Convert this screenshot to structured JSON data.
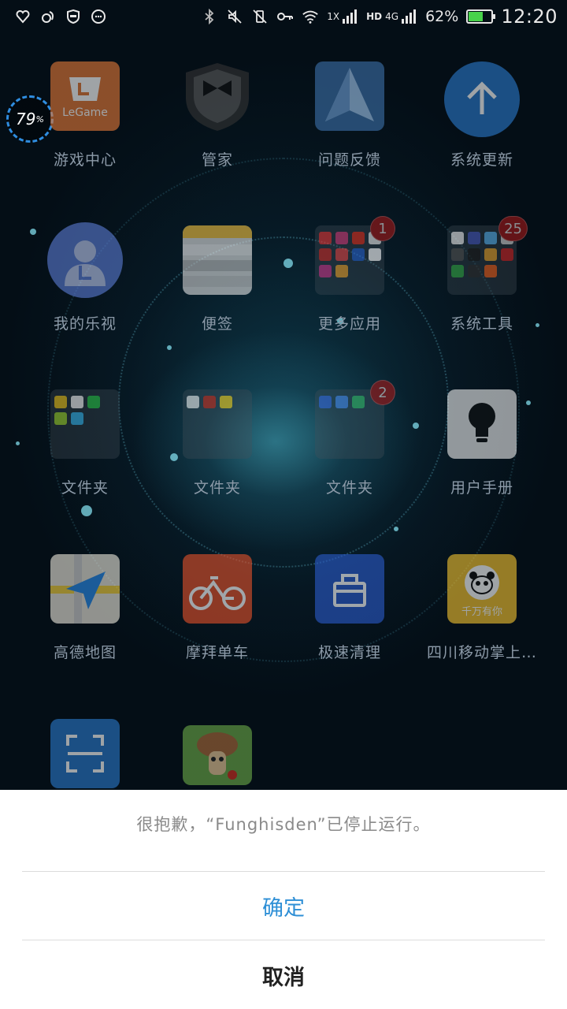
{
  "status_bar": {
    "network_type": "1X",
    "hd_label": "HD",
    "lte_label": "4G",
    "battery_percent": "62%",
    "battery_level": 0.62,
    "time": "12:20"
  },
  "memory_widget": {
    "value": "79",
    "unit": "%"
  },
  "apps": [
    {
      "label": "游戏中心",
      "icon": "legame-icon",
      "icon_text": "LeGame"
    },
    {
      "label": "管家",
      "icon": "butler-icon"
    },
    {
      "label": "问题反馈",
      "icon": "feedback-icon"
    },
    {
      "label": "系统更新",
      "icon": "system-update-icon"
    },
    {
      "label": "我的乐视",
      "icon": "my-letv-icon"
    },
    {
      "label": "便签",
      "icon": "notes-icon"
    },
    {
      "label": "更多应用",
      "icon": "more-apps-folder-icon",
      "badge": "1"
    },
    {
      "label": "系统工具",
      "icon": "system-tools-folder-icon",
      "badge": "25"
    },
    {
      "label": "文件夹",
      "icon": "folder-1-icon"
    },
    {
      "label": "文件夹",
      "icon": "folder-2-icon"
    },
    {
      "label": "文件夹",
      "icon": "folder-3-icon",
      "badge": "2"
    },
    {
      "label": "用户手册",
      "icon": "user-manual-icon"
    },
    {
      "label": "高德地图",
      "icon": "amap-icon"
    },
    {
      "label": "摩拜单车",
      "icon": "mobike-icon"
    },
    {
      "label": "极速清理",
      "icon": "speed-clean-icon"
    },
    {
      "label": "四川移动掌上…",
      "icon": "sichuan-mobile-icon",
      "icon_text": "千万有你"
    },
    {
      "label": "",
      "icon": "scanner-icon"
    },
    {
      "label": "",
      "icon": "funghisden-icon"
    }
  ],
  "dialog": {
    "message": "很抱歉，“Funghisden”已停止运行。",
    "confirm_label": "确定",
    "cancel_label": "取消"
  },
  "colors": {
    "accent_blue": "#2e8fd6",
    "badge_red": "#a01818",
    "battery_green": "#48d24a"
  }
}
